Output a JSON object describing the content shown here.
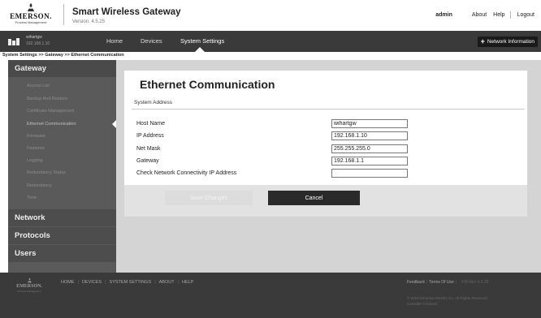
{
  "header": {
    "logo": {
      "word": "EMERSON.",
      "sub": "Process Management"
    },
    "title": "Smart Wireless Gateway",
    "version": "Version: 4.5.25",
    "user": "admin",
    "links": [
      "About",
      "Help",
      "Logout"
    ]
  },
  "navbar": {
    "device_name": "wihartgw",
    "device_ip": "192.168.1.10",
    "tabs": [
      "Home",
      "Devices",
      "System Settings"
    ],
    "active_tab": "System Settings",
    "network_info_label": "Network Information"
  },
  "breadcrumb": "System Settings >> Gateway >> Ethernet Communication",
  "sidebar": {
    "sections": [
      "Gateway",
      "Network",
      "Protocols",
      "Users"
    ],
    "gateway_items": [
      "Access List",
      "Backup And Restore",
      "Certificate Management",
      "Ethernet Communication",
      "Firmware",
      "Features",
      "Logging",
      "Redundancy Status",
      "Redundancy",
      "Time"
    ],
    "active_item": "Ethernet Communication"
  },
  "main": {
    "title": "Ethernet Communication",
    "section": "System Address",
    "fields": [
      {
        "label": "Host Name",
        "value": "wihartgw"
      },
      {
        "label": "IP Address",
        "value": "192.168.1.10"
      },
      {
        "label": "Net Mask",
        "value": "255.255.255.0"
      },
      {
        "label": "Gateway",
        "value": "192.168.1.1"
      },
      {
        "label": "Check Network Connectivity IP Address",
        "value": ""
      }
    ],
    "save_label": "Save Changes",
    "cancel_label": "Cancel"
  },
  "footer": {
    "logo_word": "EMERSON.",
    "logo_sub": "Process Management",
    "nav": [
      "HOME",
      "DEVICES",
      "SYSTEM SETTINGS",
      "ABOUT",
      "HELP"
    ],
    "feedback": "Feedback",
    "terms": "Terms Of Use",
    "version": "FW Rev 4.5.25",
    "copyright_line1": "© 2015 Emerson Electric Co. All Rights Reserved.",
    "copyright_line2": "Consider It Solved."
  },
  "colors": {
    "navbar": "#3a3a3a",
    "sidebar": "#5a5a5a",
    "cancel_button": "#2a2a2a",
    "save_button_disabled": "#dcdcdc",
    "footer": "#3a3a3a"
  },
  "icons": [
    "emerson-logo-icon",
    "gateway-device-icon",
    "plus-icon",
    "nav-pointer-icon",
    "sidebar-pointer-icon"
  ]
}
